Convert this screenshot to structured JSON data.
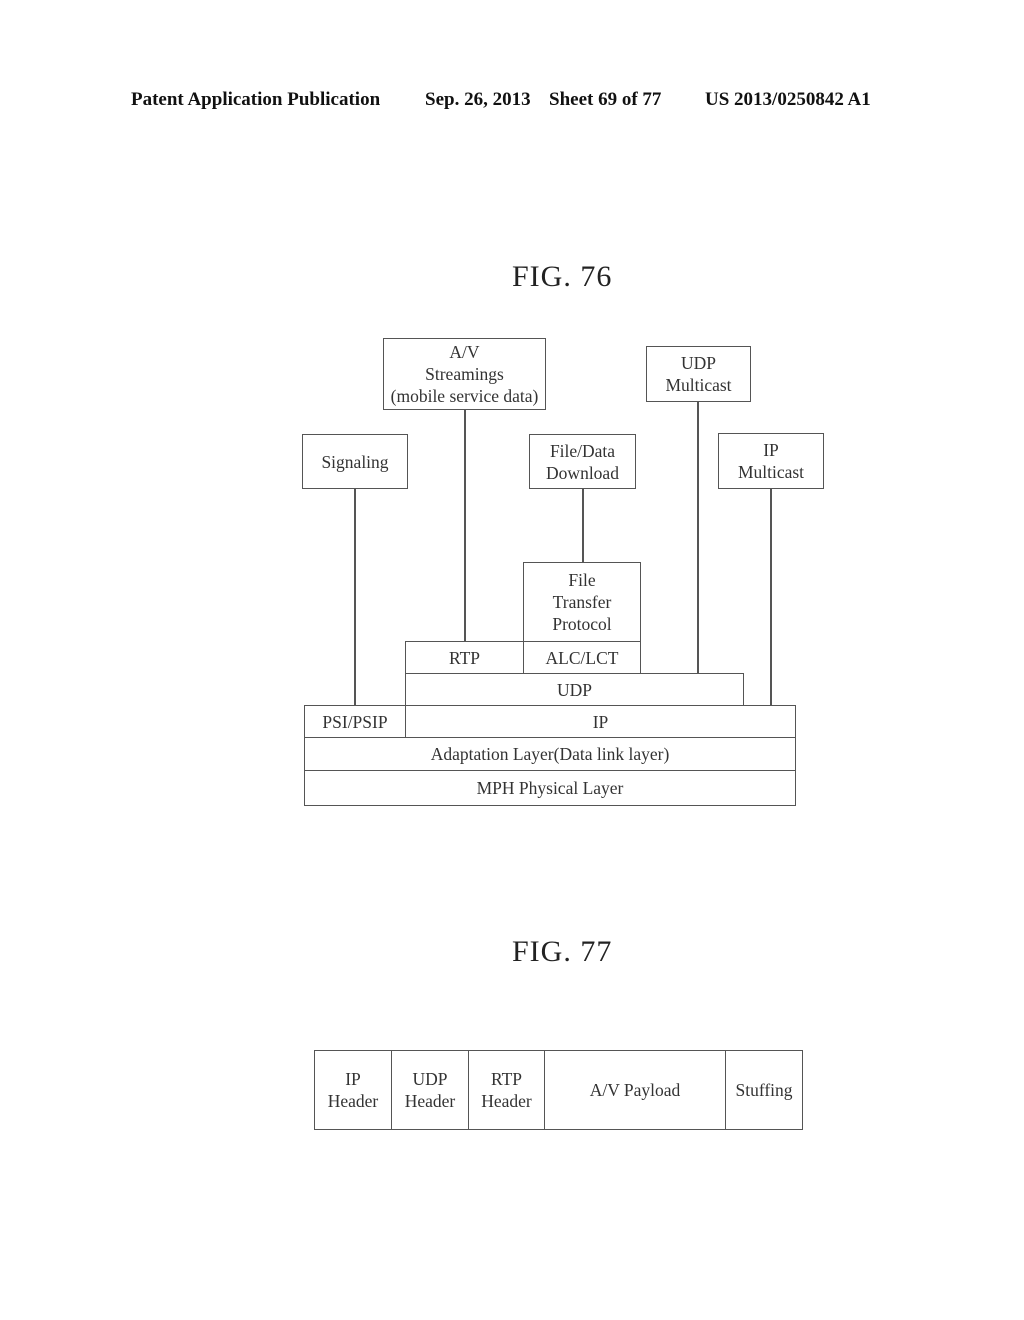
{
  "header": {
    "publication": "Patent Application Publication",
    "date": "Sep. 26, 2013",
    "sheet": "Sheet 69 of 77",
    "number": "US 2013/0250842 A1"
  },
  "fig76": {
    "title": "FIG. 76",
    "top_boxes": {
      "av_streamings": "A/V\nStreamings\n(mobile service data)",
      "udp_multicast": "UDP\nMulticast",
      "signaling": "Signaling",
      "file_data_download": "File/Data\nDownload",
      "ip_multicast": "IP\nMulticast"
    },
    "stack": {
      "file_transfer_protocol": "File\nTransfer\nProtocol",
      "rtp": "RTP",
      "alc_lct": "ALC/LCT",
      "udp": "UDP",
      "psi_psip": "PSI/PSIP",
      "ip": "IP",
      "adaptation_layer": "Adaptation Layer(Data link layer)",
      "physical_layer": "MPH Physical Layer"
    }
  },
  "fig77": {
    "title": "FIG. 77",
    "fields": [
      "IP\nHeader",
      "UDP\nHeader",
      "RTP\nHeader",
      "A/V Payload",
      "Stuffing"
    ]
  }
}
